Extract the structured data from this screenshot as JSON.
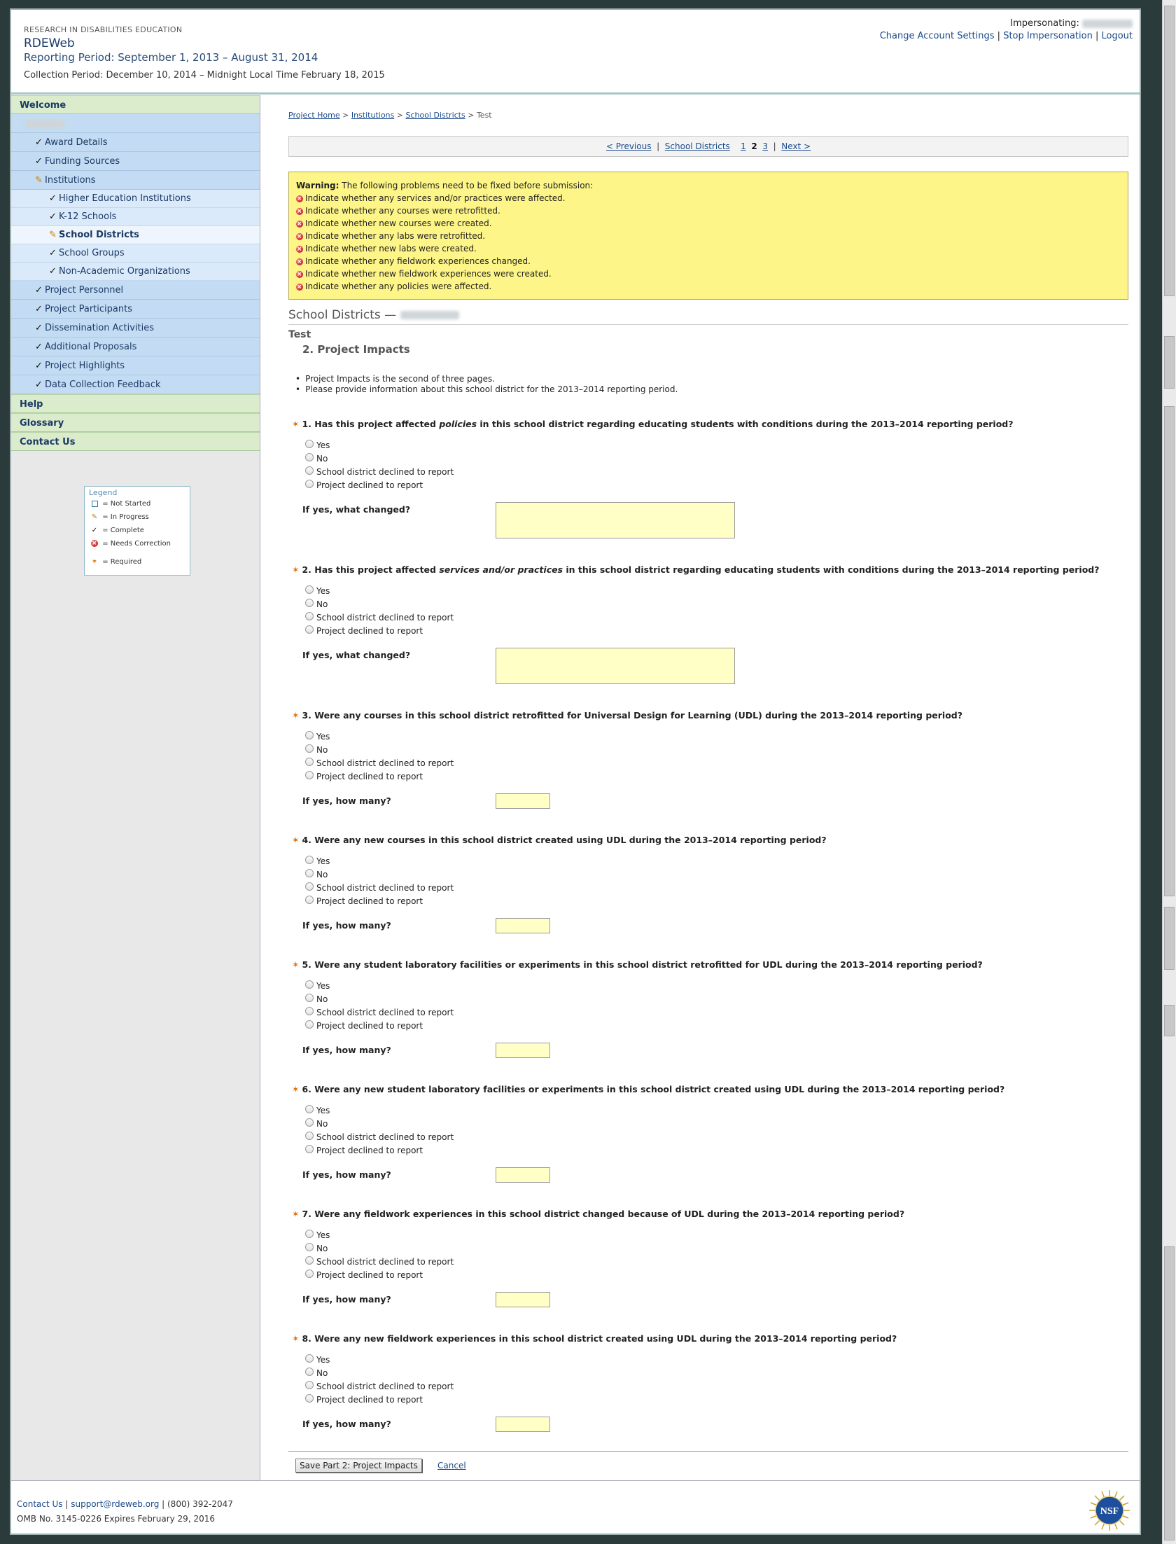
{
  "header": {
    "org": "RESEARCH IN DISABILITIES EDUCATION",
    "app_title": "RDEWeb",
    "reporting_period": "Reporting Period: September 1, 2013 – August 31, 2014",
    "collection_period": "Collection Period: December 10, 2014 – Midnight Local Time February 18, 2015",
    "impersonating_label": "Impersonating:",
    "links": {
      "change_settings": "Change Account Settings",
      "stop_impersonation": "Stop Impersonation",
      "logout": "Logout"
    }
  },
  "sidebar": {
    "welcome": "Welcome",
    "items_l1_top": [
      "Award Details",
      "Funding Sources"
    ],
    "institutions": "Institutions",
    "institution_children": [
      "Higher Education Institutions",
      "K-12 Schools",
      "School Districts",
      "School Groups",
      "Non-Academic Organizations"
    ],
    "items_l1_bottom": [
      "Project Personnel",
      "Project Participants",
      "Dissemination Activities",
      "Additional Proposals",
      "Project Highlights",
      "Data Collection Feedback"
    ],
    "help": "Help",
    "glossary": "Glossary",
    "contact": "Contact Us"
  },
  "legend": {
    "title": "Legend",
    "not_started": "= Not Started",
    "in_progress": "= In Progress",
    "complete": "= Complete",
    "needs_correction": "= Needs Correction",
    "required": "= Required"
  },
  "breadcrumb": {
    "home": "Project Home",
    "institutions": "Institutions",
    "school_districts": "School Districts",
    "current": "Test",
    "sep": ">"
  },
  "pager": {
    "previous": "< Previous",
    "section": "School Districts",
    "pages": [
      "1",
      "2",
      "3"
    ],
    "current_page": "2",
    "next": "Next >"
  },
  "warning": {
    "label": "Warning:",
    "message": "The following problems need to be fixed before submission:",
    "items": [
      "Indicate whether any services and/or practices were affected.",
      "Indicate whether any courses were retrofitted.",
      "Indicate whether new courses were created.",
      "Indicate whether any labs were retrofitted.",
      "Indicate whether new labs were created.",
      "Indicate whether any fieldwork experiences changed.",
      "Indicate whether new fieldwork experiences were created.",
      "Indicate whether any policies were affected."
    ]
  },
  "section": {
    "title": "School Districts —",
    "sub": "Test",
    "part": "2. Project Impacts",
    "intro": [
      "Project Impacts is the second of three pages.",
      "Please provide information about this school district for the 2013–2014 reporting period."
    ]
  },
  "options": [
    "Yes",
    "No",
    "School district declined to report",
    "Project declined to report"
  ],
  "questions": [
    {
      "pre": "1. Has this project affected ",
      "em": "policies",
      "post": " in this school district regarding educating students with conditions during the 2013–2014 reporting period?",
      "followup": "If yes, what changed?"
    },
    {
      "pre": "2. Has this project affected ",
      "em": "services and/or practices",
      "post": " in this school district regarding educating students with conditions during the 2013–2014 reporting period?",
      "followup": "If yes, what changed?"
    },
    {
      "pre": "3. Were any courses in this school district retrofitted for Universal Design for Learning (UDL) during the 2013–2014 reporting period?",
      "em": "",
      "post": "",
      "followup": "If yes, how many?"
    },
    {
      "pre": "4. Were any new courses in this school district created using UDL during the 2013–2014 reporting period?",
      "em": "",
      "post": "",
      "followup": "If yes, how many?"
    },
    {
      "pre": "5. Were any student laboratory facilities or experiments in this school district retrofitted for UDL during the 2013–2014 reporting period?",
      "em": "",
      "post": "",
      "followup": "If yes, how many?"
    },
    {
      "pre": "6. Were any new student laboratory facilities or experiments in this school district created using UDL during the 2013–2014 reporting period?",
      "em": "",
      "post": "",
      "followup": "If yes, how many?"
    },
    {
      "pre": "7. Were any fieldwork experiences in this school district changed because of UDL during the 2013–2014 reporting period?",
      "em": "",
      "post": "",
      "followup": "If yes, how many?"
    },
    {
      "pre": "8. Were any new fieldwork experiences in this school district created using UDL during the 2013–2014 reporting period?",
      "em": "",
      "post": "",
      "followup": "If yes, how many?"
    }
  ],
  "actions": {
    "save": "Save Part 2: Project Impacts",
    "cancel": "Cancel"
  },
  "footer": {
    "contact": "Contact Us",
    "email": "support@rdeweb.org",
    "phone": "(800) 392-2047",
    "omb": "OMB No. 3145-0226 Expires February 29, 2016",
    "nsf_logo": "NSF"
  }
}
